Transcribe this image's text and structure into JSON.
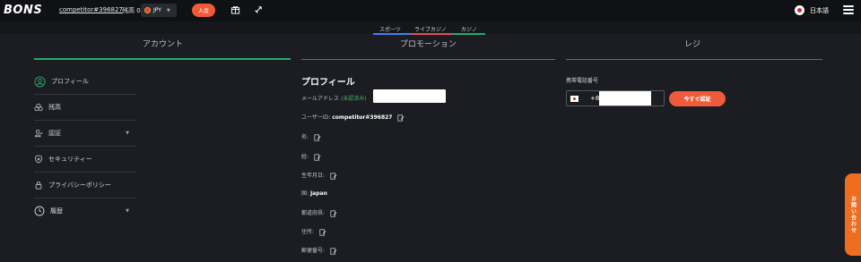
{
  "header": {
    "logo": "BONS",
    "username": "competitor#396827",
    "balance_label": "残高",
    "balance_value": "0",
    "currency": "JPY",
    "deposit_label": "入金",
    "language": "日本語"
  },
  "subnav": {
    "tabs": [
      "スポーツ",
      "ライブカジノ",
      "カジノ"
    ],
    "colors": [
      "#3b82f6",
      "#e84b5a",
      "#1fae6a"
    ]
  },
  "main_tabs": [
    "アカウント",
    "プロモーション",
    "レジ"
  ],
  "accent": "#1fae6a",
  "sidebar": {
    "items": [
      {
        "label": "プロフィール",
        "icon": "user-circle-icon",
        "active": true
      },
      {
        "label": "残高",
        "icon": "coins-icon"
      },
      {
        "label": "認証",
        "icon": "verify-icon",
        "has_arrow": true
      },
      {
        "label": "セキュリティー",
        "icon": "shield-icon"
      },
      {
        "label": "プライバシーポリシー",
        "icon": "lock-icon"
      },
      {
        "label": "履歴",
        "icon": "clock-icon",
        "has_arrow": true
      }
    ]
  },
  "profile": {
    "title": "プロフィール",
    "email_label": "メールアドレス",
    "email_status": "(未認済み)",
    "userid_label": "ユーザーID:",
    "userid_value": "competitor#396827",
    "first_name_label": "名:",
    "last_name_label": "姓:",
    "birthday_label": "生年月日:",
    "country_label": "国:",
    "country_value": "Japan",
    "prefecture_label": "都道府県:",
    "address_label": "住所:",
    "postal_label": "郵便番号:"
  },
  "phone": {
    "label": "携帯電話番号",
    "code": "+81",
    "verify_label": "今すぐ認証"
  },
  "contact_label": "お問い合わせ"
}
